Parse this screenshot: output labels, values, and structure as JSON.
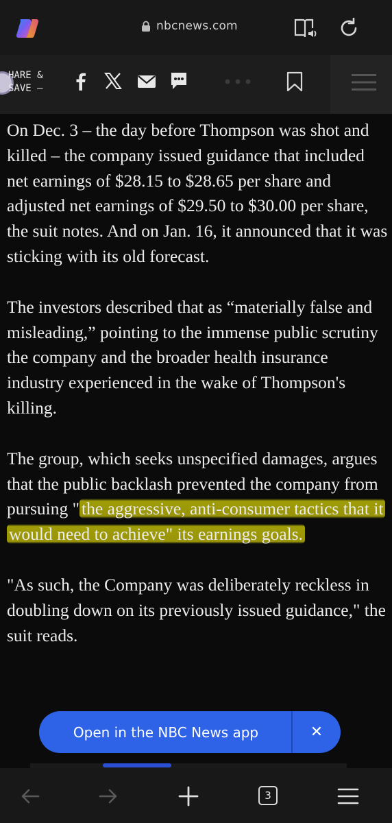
{
  "browser": {
    "url": "nbcnews.com",
    "icons": [
      "copilot-icon",
      "lock-icon",
      "read-aloud-icon",
      "reload-icon"
    ]
  },
  "share_bar": {
    "label": "HARE &\nSAVE —",
    "icons": [
      "facebook-icon",
      "x-icon",
      "email-icon",
      "sms-icon",
      "more-icon",
      "bookmark-icon",
      "menu-icon"
    ]
  },
  "article": {
    "paragraphs": [
      {
        "text": "On Dec. 3 – the day before Thompson was shot and killed – the company issued guidance that included net earnings of $28.15 to $28.65 per share and adjusted net earnings of $29.50 to $30.00 per share, the suit notes. And on Jan. 16, it announced that it was sticking with its old forecast."
      },
      {
        "text": "The investors described that as “materially false and misleading,” pointing to the immense public scrutiny the company and the broader health insurance industry experienced in the wake of Thompson's killing."
      },
      {
        "before": "The group, which seeks unspecified damages, argues that the public backlash prevented the company from pursuing \"",
        "highlighted": "the aggressive, anti-consumer tactics that it would need to achieve\" its earnings goals.",
        "after": ""
      },
      {
        "text": "\"As such, the Company was deliberately reckless in doubling down on its previously issued guidance,\" the suit reads."
      }
    ],
    "highlight_color": "#a8a308"
  },
  "app_banner": {
    "label": "Open in the NBC News app",
    "close": "✕",
    "color": "#2e63e8"
  },
  "bottom_nav": {
    "tab_count": "3",
    "icons": [
      "back-icon",
      "forward-icon",
      "new-tab-icon",
      "tabs-icon",
      "menu-icon"
    ]
  }
}
